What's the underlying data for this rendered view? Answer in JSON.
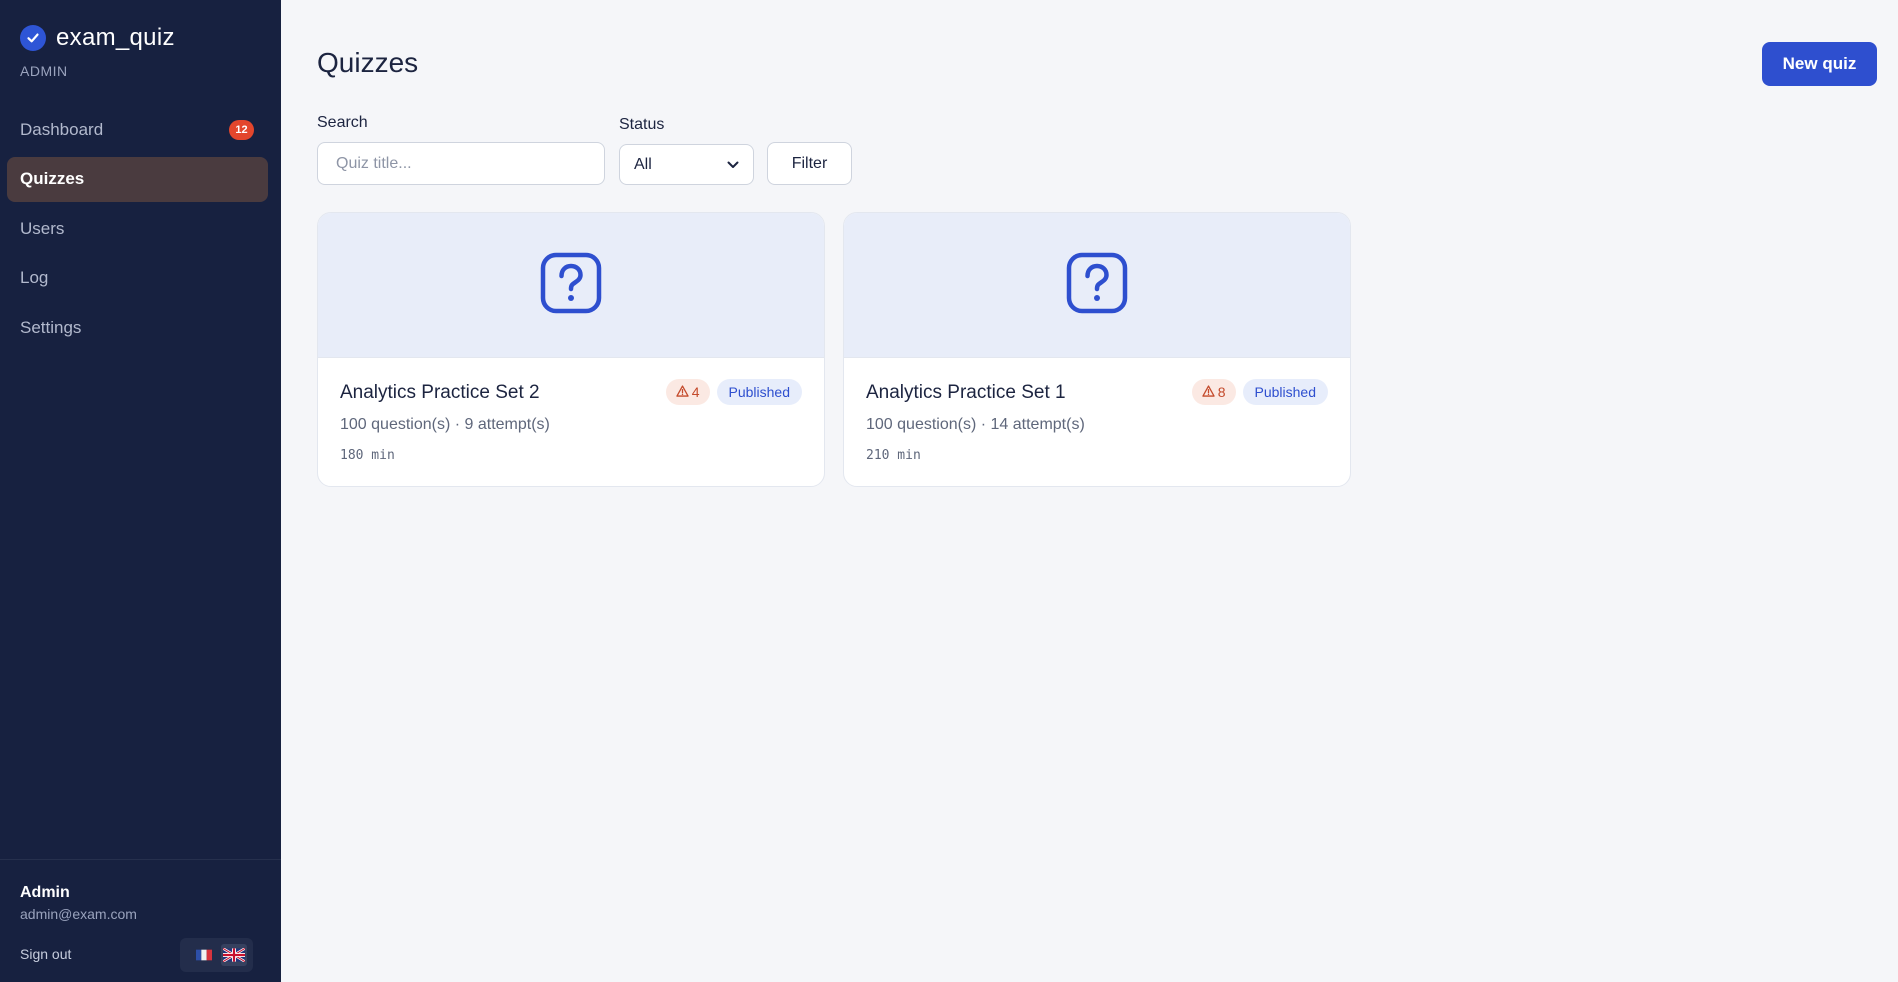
{
  "app": {
    "name": "exam_quiz",
    "role": "ADMIN"
  },
  "nav": [
    {
      "label": "Dashboard",
      "badge": "12",
      "active": false
    },
    {
      "label": "Quizzes",
      "active": true
    },
    {
      "label": "Users",
      "active": false
    },
    {
      "label": "Log",
      "active": false
    },
    {
      "label": "Settings",
      "active": false
    }
  ],
  "user": {
    "name": "Admin",
    "email": "admin@exam.com",
    "sign_out": "Sign out"
  },
  "languages": [
    {
      "code": "fr",
      "icon": "flag-fr-icon",
      "active": false
    },
    {
      "code": "en",
      "icon": "flag-gb-icon",
      "active": true
    }
  ],
  "page": {
    "title": "Quizzes",
    "new_quiz_label": "New quiz"
  },
  "filters": {
    "search_label": "Search",
    "search_placeholder": "Quiz title...",
    "status_label": "Status",
    "status_value": "All",
    "filter_label": "Filter"
  },
  "quizzes": [
    {
      "title": "Analytics Practice Set 2",
      "warnings": "4",
      "status": "Published",
      "meta": "100 question(s) · 9 attempt(s)",
      "duration": "180 min"
    },
    {
      "title": "Analytics Practice Set 1",
      "warnings": "8",
      "status": "Published",
      "meta": "100 question(s) · 14 attempt(s)",
      "duration": "210 min"
    }
  ],
  "colors": {
    "sidebar_bg": "#172140",
    "accent": "#2e4fcf",
    "active_nav_bg": "#4a3b3f",
    "badge_red": "#e3462c",
    "card_banner_bg": "#e8edf9"
  }
}
